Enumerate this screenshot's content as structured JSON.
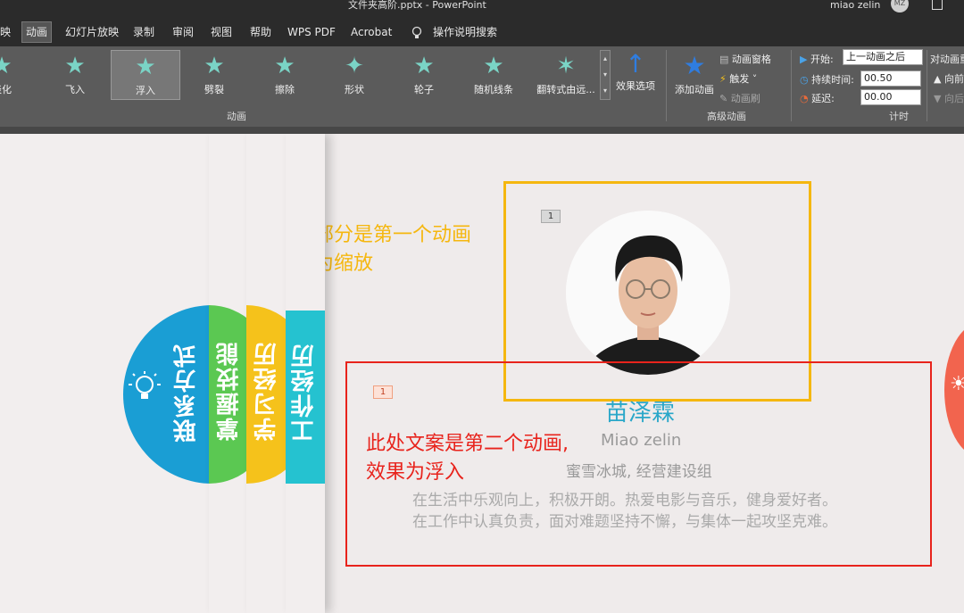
{
  "window": {
    "title": "文件夹高阶.pptx  -  PowerPoint",
    "user": "miao zelin",
    "avatar_initials": "MZ"
  },
  "tabs": [
    {
      "label": "映",
      "active": false
    },
    {
      "label": "动画",
      "active": true
    },
    {
      "label": "幻灯片放映",
      "active": false
    },
    {
      "label": "录制",
      "active": false
    },
    {
      "label": "审阅",
      "active": false
    },
    {
      "label": "视图",
      "active": false
    },
    {
      "label": "帮助",
      "active": false
    },
    {
      "label": "WPS PDF",
      "active": false
    },
    {
      "label": "Acrobat",
      "active": false
    },
    {
      "label": "操作说明搜索",
      "active": false
    }
  ],
  "ribbon": {
    "gallery": [
      {
        "label": "淡化",
        "icon": "star-icon"
      },
      {
        "label": "飞入",
        "icon": "star-fly-icon"
      },
      {
        "label": "浮入",
        "icon": "star-float-icon",
        "selected": true
      },
      {
        "label": "劈裂",
        "icon": "star-split-icon"
      },
      {
        "label": "擦除",
        "icon": "star-wipe-icon"
      },
      {
        "label": "形状",
        "icon": "star-shape-icon"
      },
      {
        "label": "轮子",
        "icon": "star-wheel-icon"
      },
      {
        "label": "随机线条",
        "icon": "star-lines-icon"
      },
      {
        "label": "翻转式由远...",
        "icon": "star-flip-icon"
      }
    ],
    "effect_options": "效果选项",
    "animation_group": "动画",
    "add_animation": "添加动画",
    "animation_pane": "动画窗格",
    "trigger": "触发",
    "animation_painter": "动画刷",
    "advanced_group": "高级动画",
    "start_label": "开始:",
    "start_value": "上一动画之后",
    "duration_label": "持续时间:",
    "duration_value": "00.50",
    "delay_label": "延迟:",
    "delay_value": "00.00",
    "timing_group": "计时",
    "reorder_label": "对动画重",
    "move_earlier": "向前",
    "move_later": "向后"
  },
  "slide": {
    "tabs": [
      {
        "label": "联系方式",
        "color": "#1a9ed4"
      },
      {
        "label": "掌握技能",
        "color": "#5bc852"
      },
      {
        "label": "学习经历",
        "color": "#f5c21b"
      },
      {
        "label": "工作经历",
        "color": "#25c2d0"
      }
    ],
    "anim_badge_1": "1",
    "anim_badge_2": "1",
    "note_yellow": [
      "图片部分是第一个动画",
      "效果为缩放"
    ],
    "note_red": [
      "此处文案是第二个动画,",
      "效果为浮入"
    ],
    "name_cn": "苗泽霖",
    "name_en": "Miao zelin",
    "subtitle": "蜜雪冰城, 经营建设组",
    "desc_1": "在生活中乐观向上，积极开朗。热爱电影与音乐，健身爱好者。",
    "desc_2": "在工作中认真负责，面对难题坚持不懈，与集体一起攻坚克难。",
    "colors": {
      "yellow_box": "#f5b70f",
      "red_box": "#e8231c",
      "name": "#2aa7c9"
    }
  }
}
